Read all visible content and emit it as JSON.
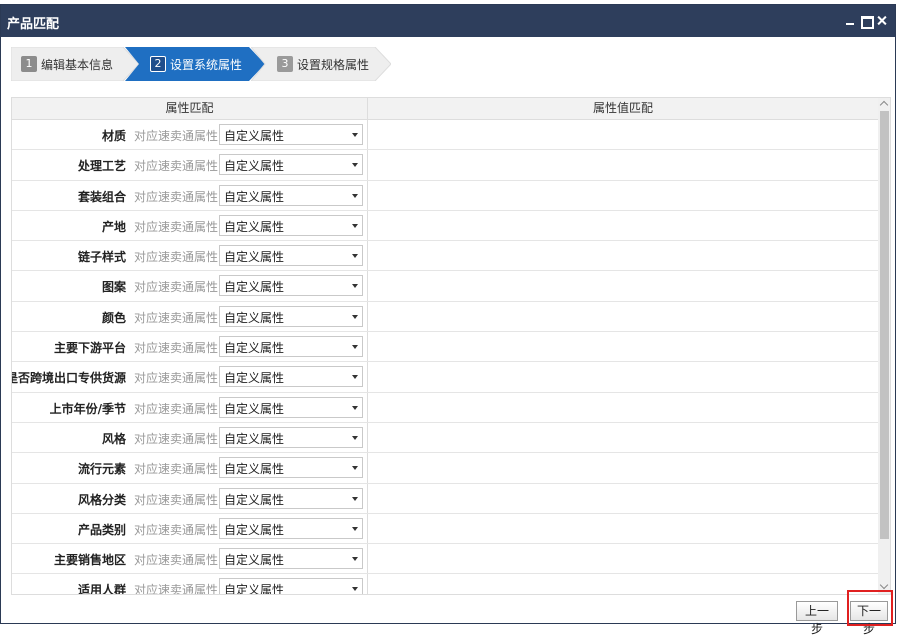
{
  "window": {
    "title": "产品匹配"
  },
  "steps": [
    {
      "num": "1",
      "label": "编辑基本信息"
    },
    {
      "num": "2",
      "label": "设置系统属性"
    },
    {
      "num": "3",
      "label": "设置规格属性"
    }
  ],
  "table": {
    "headers": [
      "属性匹配",
      "属性值匹配"
    ],
    "hint_label": "对应速卖通属性:",
    "default_option": "自定义属性",
    "rows": [
      {
        "name": "材质"
      },
      {
        "name": "处理工艺"
      },
      {
        "name": "套装组合"
      },
      {
        "name": "产地"
      },
      {
        "name": "链子样式"
      },
      {
        "name": "图案"
      },
      {
        "name": "颜色"
      },
      {
        "name": "主要下游平台"
      },
      {
        "name": "是否跨境出口专供货源"
      },
      {
        "name": "上市年份/季节"
      },
      {
        "name": "风格"
      },
      {
        "name": "流行元素"
      },
      {
        "name": "风格分类"
      },
      {
        "name": "产品类别"
      },
      {
        "name": "主要销售地区"
      },
      {
        "name": "适用人群"
      }
    ]
  },
  "footer": {
    "prev_label": "上一步",
    "next_label": "下一步"
  },
  "colors": {
    "titlebar": "#2e3e5c",
    "active_step": "#1f6fc2",
    "inactive_step": "#eeeeee",
    "highlight": "#e02020"
  }
}
